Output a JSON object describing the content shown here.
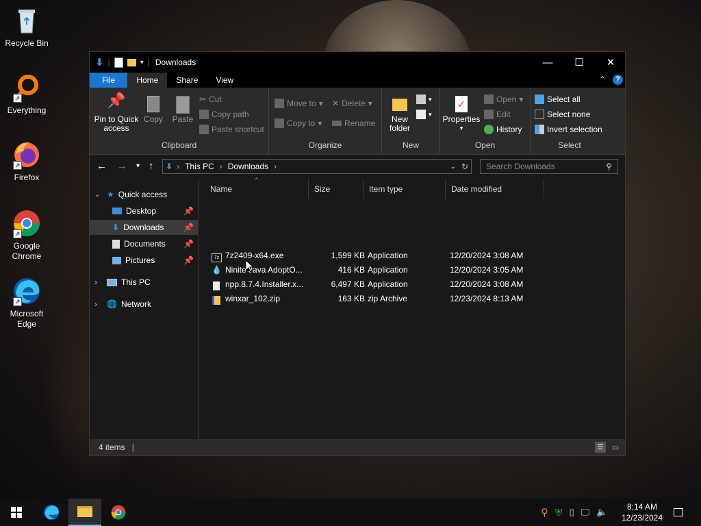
{
  "desktop": {
    "icons": [
      {
        "label_line1": "Recycle Bin",
        "label_line2": ""
      },
      {
        "label_line1": "Everything",
        "label_line2": ""
      },
      {
        "label_line1": "Firefox",
        "label_line2": ""
      },
      {
        "label_line1": "Google",
        "label_line2": "Chrome"
      },
      {
        "label_line1": "Microsoft",
        "label_line2": "Edge"
      }
    ]
  },
  "window": {
    "title": "Downloads",
    "controls": {
      "minimize": "—",
      "maximize": "☐",
      "close": "✕"
    },
    "tabs": {
      "file": "File",
      "home": "Home",
      "share": "Share",
      "view": "View"
    },
    "ribbon": {
      "clipboard": {
        "pin_line1": "Pin to Quick",
        "pin_line2": "access",
        "copy": "Copy",
        "paste": "Paste",
        "cut": "Cut",
        "copy_path": "Copy path",
        "paste_shortcut": "Paste shortcut",
        "label": "Clipboard"
      },
      "organize": {
        "move_to": "Move to",
        "copy_to": "Copy to",
        "delete": "Delete",
        "rename": "Rename",
        "label": "Organize"
      },
      "new": {
        "new_folder_line1": "New",
        "new_folder_line2": "folder",
        "label": "New"
      },
      "open": {
        "properties": "Properties",
        "open": "Open",
        "edit": "Edit",
        "history": "History",
        "label": "Open"
      },
      "select": {
        "select_all": "Select all",
        "select_none": "Select none",
        "invert": "Invert selection",
        "label": "Select"
      }
    },
    "address": {
      "segments": [
        "This PC",
        "Downloads"
      ],
      "search_placeholder": "Search Downloads"
    },
    "nav": {
      "quick_access": "Quick access",
      "items": [
        {
          "label": "Desktop",
          "pinned": true
        },
        {
          "label": "Downloads",
          "pinned": true
        },
        {
          "label": "Documents",
          "pinned": true
        },
        {
          "label": "Pictures",
          "pinned": true
        }
      ],
      "this_pc": "This PC",
      "network": "Network"
    },
    "columns": {
      "name": "Name",
      "size": "Size",
      "type": "Item type",
      "date": "Date modified"
    },
    "files": [
      {
        "name": "7z2409-x64.exe",
        "size": "1,599 KB",
        "type": "Application",
        "date": "12/20/2024 3:08 AM",
        "icon": "7zip-icon"
      },
      {
        "name": "Ninite Java AdoptO...",
        "size": "416 KB",
        "type": "Application",
        "date": "12/20/2024 3:05 AM",
        "icon": "ninite-icon"
      },
      {
        "name": "npp.8.7.4.Installer.x...",
        "size": "6,497 KB",
        "type": "Application",
        "date": "12/20/2024 3:08 AM",
        "icon": "file-icon"
      },
      {
        "name": "winxar_102.zip",
        "size": "163 KB",
        "type": "zip Archive",
        "date": "12/23/2024 8:13 AM",
        "icon": "zip-icon"
      }
    ],
    "status": {
      "items": "4 items"
    }
  },
  "taskbar": {
    "time": "8:14 AM",
    "date": "12/23/2024"
  },
  "colors": {
    "accent": "#1976d2",
    "window_bg": "#191919",
    "ribbon_bg": "#2b2b2b",
    "taskbar_bg": "#101010"
  }
}
